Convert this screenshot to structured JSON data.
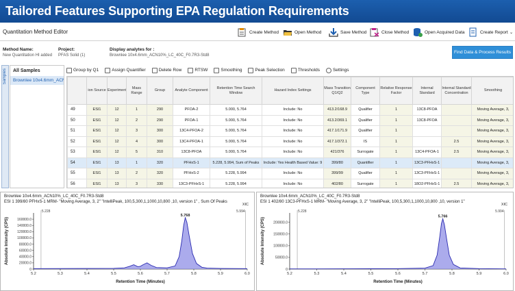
{
  "banner_title": "Tailored Features Supporting EPA Regulation Requirements",
  "app_title": "Quantitation Method Editor",
  "toolbar": {
    "create": "Create Method",
    "open": "Open Method",
    "save": "Save Method",
    "close": "Close Method",
    "open_acquired": "Open Acquired Data",
    "create_report": "Create Report"
  },
  "info": {
    "method_label": "Method Name:",
    "method_value": "New Quantitation HI added",
    "project_label": "Project:",
    "project_value": "PFAS Solid (1)",
    "display_label": "Display analytes for :",
    "display_value": "Brownlee 10x4.6mm_ACN10%_LC_40C_F0.7R3-Std8",
    "find_button": "Find Data & Process Results"
  },
  "left": {
    "tab_label": "Samples",
    "header": "All Samples",
    "selected": "Brownlee 10x4.6mm_ACN"
  },
  "grid_tools": [
    "Group by Q1",
    "Assign Quantifier",
    "Delete Row",
    "RTSW",
    "Smoothing",
    "Peak Selection",
    "Thresholds",
    "Settings"
  ],
  "columns": [
    "",
    "ion Source",
    "Experiment",
    "Mass Range",
    "Group",
    "Analyte Component",
    "Retention Time Search Window",
    "Hazard Index Settings",
    "Mass Transition Q1/Q2",
    "Component Type",
    "Relative Response Factor",
    "Internal Standard",
    "Internal Standard Concentration",
    "Smoothing"
  ],
  "rows": [
    {
      "n": "49",
      "src": "ESI1",
      "exp": "12",
      "mr": "1",
      "grp": "290",
      "comp": "PFOA-2",
      "rtsw": "5.000, 5.764",
      "hi": "Include: No",
      "mt": "413.2/168.9",
      "type": "Qualifier",
      "rrf": "1",
      "is": "13C8-PFOA",
      "isc": "",
      "sm": "Moving Average, 3,"
    },
    {
      "n": "50",
      "src": "ESI1",
      "exp": "12",
      "mr": "2",
      "grp": "290",
      "comp": "PFOA-1",
      "rtsw": "5.000, 5.764",
      "hi": "Include: No",
      "mt": "413.2/369.1",
      "type": "Qualifier",
      "rrf": "1",
      "is": "13C8-PFOA",
      "isc": "",
      "sm": "Moving Average, 3,"
    },
    {
      "n": "51",
      "src": "ESI1",
      "exp": "12",
      "mr": "3",
      "grp": "300",
      "comp": "13C4-PFOA-2",
      "rtsw": "5.000, 5.764",
      "hi": "Include: No",
      "mt": "417.1/171.9",
      "type": "Qualifier",
      "rrf": "1",
      "is": "",
      "isc": "",
      "sm": "Moving Average, 3,"
    },
    {
      "n": "52",
      "src": "ESI1",
      "exp": "12",
      "mr": "4",
      "grp": "300",
      "comp": "13C4-PFOA-1",
      "rtsw": "5.000, 5.764",
      "hi": "Include: No",
      "mt": "417.1/372.1",
      "type": "IS",
      "rrf": "1",
      "is": "",
      "isc": "2.5",
      "sm": "Moving Average, 3,"
    },
    {
      "n": "53",
      "src": "ESI1",
      "exp": "12",
      "mr": "5",
      "grp": "310",
      "comp": "13C8-PFOA",
      "rtsw": "5.000, 5.764",
      "hi": "Include: No",
      "mt": "421/376",
      "type": "Surrogate",
      "rrf": "1",
      "is": "13C4-PFOA-1",
      "isc": "2.5",
      "sm": "Moving Average, 3,"
    },
    {
      "n": "54",
      "src": "ESI1",
      "exp": "13",
      "mr": "1",
      "grp": "320",
      "comp": "PFHxS-1",
      "rtsw": "5.228, 5.994, Sum of Peaks",
      "hi": "Include: Yes   Health Based Value: 9",
      "mt": "399/80",
      "type": "Quantifier",
      "rrf": "1",
      "is": "13C3-PFHxS-1",
      "isc": "",
      "sm": "Moving Average, 3,"
    },
    {
      "n": "55",
      "src": "ESI1",
      "exp": "13",
      "mr": "2",
      "grp": "320",
      "comp": "PFHxS-2",
      "rtsw": "5.228, 5.994",
      "hi": "Include: No",
      "mt": "399/99",
      "type": "Qualifier",
      "rrf": "1",
      "is": "13C3-PFHxS-1",
      "isc": "",
      "sm": "Moving Average, 3,"
    },
    {
      "n": "56",
      "src": "ESI1",
      "exp": "13",
      "mr": "3",
      "grp": "330",
      "comp": "13C3-PFHxS-1",
      "rtsw": "5.228, 5.994",
      "hi": "Include: No",
      "mt": "402/80",
      "type": "Surrogate",
      "rrf": "1",
      "is": "18O2-PFHxS-1",
      "isc": "2.5",
      "sm": "Moving Average, 3,"
    }
  ],
  "chart_data": [
    {
      "type": "line",
      "title": "Brownlee 10x4.6mm_ACN10%_LC_40C_F0.7R3-Std8",
      "subtitle": "ESI 1 399/80 PFHxS-1 MRM- \"Moving Average, 3, 2\" \"IntelliPeak, 100,5,300,1,1000,10,800 ,10, version 1\" , Sum Of Peaks",
      "corner_label": "XIC",
      "xlabel": "Retention Time (Minutes)",
      "ylabel": "Absolute Intensity (CPS)",
      "xlim": [
        5.2,
        6.0
      ],
      "ylim": [
        0,
        180000
      ],
      "xticks": [
        5.2,
        5.3,
        5.4,
        5.5,
        5.6,
        5.7,
        5.8,
        5.9,
        6.0
      ],
      "yticks": [
        0,
        20000,
        40000,
        60000,
        80000,
        100000,
        120000,
        140000,
        160000
      ],
      "ytick_labels": [
        "0",
        "20000.0",
        "40000.0",
        "60000.0",
        "80000.0",
        "100000.0",
        "120000.0",
        "140000.0",
        "160000.0"
      ],
      "window_start_label": "5.228",
      "window_end_label": "5.994",
      "peak_label": "5.768",
      "x": [
        5.2,
        5.3,
        5.4,
        5.5,
        5.54,
        5.56,
        5.575,
        5.59,
        5.6,
        5.61,
        5.625,
        5.64,
        5.66,
        5.7,
        5.73,
        5.745,
        5.755,
        5.762,
        5.768,
        5.774,
        5.782,
        5.795,
        5.81,
        5.83,
        5.85,
        5.9,
        6.0
      ],
      "y": [
        1500,
        1800,
        2000,
        2500,
        4000,
        9000,
        14000,
        8000,
        9000,
        14000,
        20000,
        12000,
        5000,
        4000,
        10000,
        40000,
        90000,
        140000,
        165000,
        150000,
        110000,
        50000,
        18000,
        6000,
        3000,
        2000,
        1500
      ]
    },
    {
      "type": "line",
      "title": "Brownlee 10x4.6mm_ACN10%_LC_40C_F0.7R3-Std8",
      "subtitle": "ESI 1 402/80 13C3-PFHxS-1 MRM- \"Moving Average, 3, 2\" \"IntelliPeak, 100,5,300,1,1000,10,800 ,10, version 1\"",
      "corner_label": "XIC",
      "xlabel": "Retention Time (Minutes)",
      "ylabel": "Absolute Intensity (CPS)",
      "xlim": [
        5.2,
        6.0
      ],
      "ylim": [
        0,
        240000
      ],
      "xticks": [
        5.2,
        5.3,
        5.4,
        5.5,
        5.6,
        5.7,
        5.8,
        5.9,
        6.0
      ],
      "yticks": [
        0,
        50000,
        100000,
        150000,
        200000
      ],
      "ytick_labels": [
        "0",
        "50000.0",
        "100000.0",
        "150000.0",
        "200000.0"
      ],
      "window_start_label": "5.228",
      "window_end_label": "5.994",
      "peak_label": "5.766",
      "x": [
        5.2,
        5.3,
        5.4,
        5.5,
        5.6,
        5.7,
        5.73,
        5.745,
        5.755,
        5.761,
        5.766,
        5.772,
        5.78,
        5.79,
        5.805,
        5.83,
        5.9,
        6.0
      ],
      "y": [
        1000,
        1000,
        1200,
        1500,
        2000,
        4000,
        15000,
        60000,
        140000,
        195000,
        215000,
        190000,
        130000,
        60000,
        20000,
        5000,
        2000,
        1000
      ]
    }
  ]
}
